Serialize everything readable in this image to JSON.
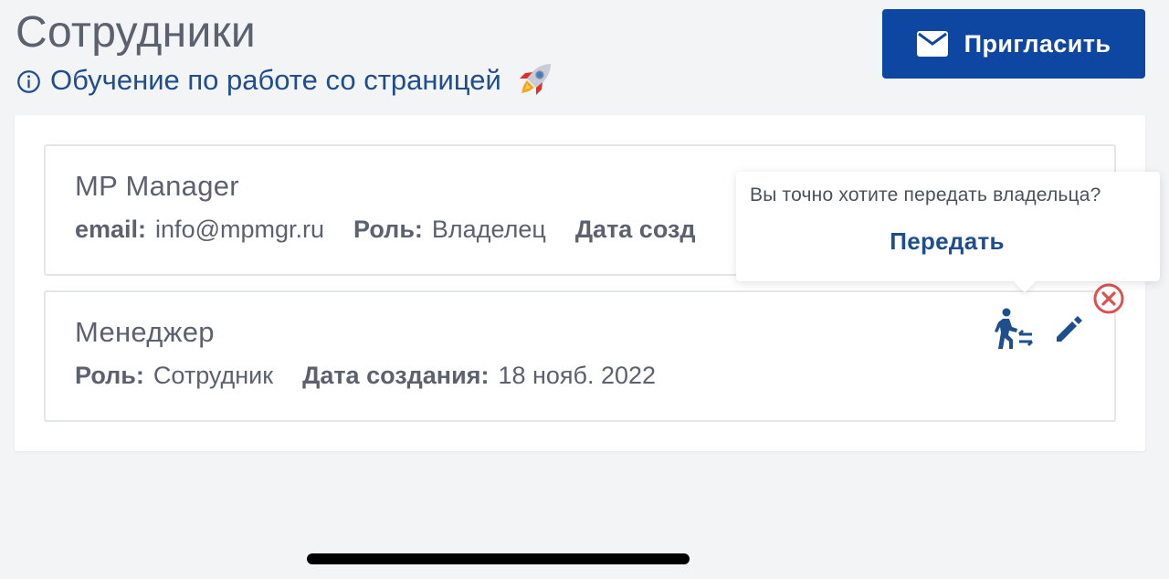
{
  "header": {
    "title": "Сотрудники",
    "tutorial_link": "Обучение по работе со страницей",
    "invite_label": "Пригласить"
  },
  "employees": [
    {
      "name": "MP Manager",
      "fields": [
        {
          "label": "email:",
          "value": "info@mpmgr.ru"
        },
        {
          "label": "Роль:",
          "value": "Владелец"
        },
        {
          "label": "Дата созд",
          "value": ""
        }
      ]
    },
    {
      "name": "Менеджер",
      "fields": [
        {
          "label": "Роль:",
          "value": "Сотрудник"
        },
        {
          "label": "Дата создания:",
          "value": "18 нояб. 2022"
        }
      ]
    }
  ],
  "popover": {
    "question": "Вы точно хотите передать владельца?",
    "confirm_label": "Передать"
  },
  "colors": {
    "accent": "#0d47a1",
    "link": "#1f4e8c",
    "danger": "#d9534f",
    "text": "#5b616e",
    "background": "#f3f4f6"
  },
  "icons": {
    "info": "info-circle-icon",
    "rocket": "rocket-icon",
    "mail": "mail-icon",
    "transfer_owner": "transfer-owner-icon",
    "edit": "pencil-icon",
    "cancel": "close-circle-icon"
  }
}
